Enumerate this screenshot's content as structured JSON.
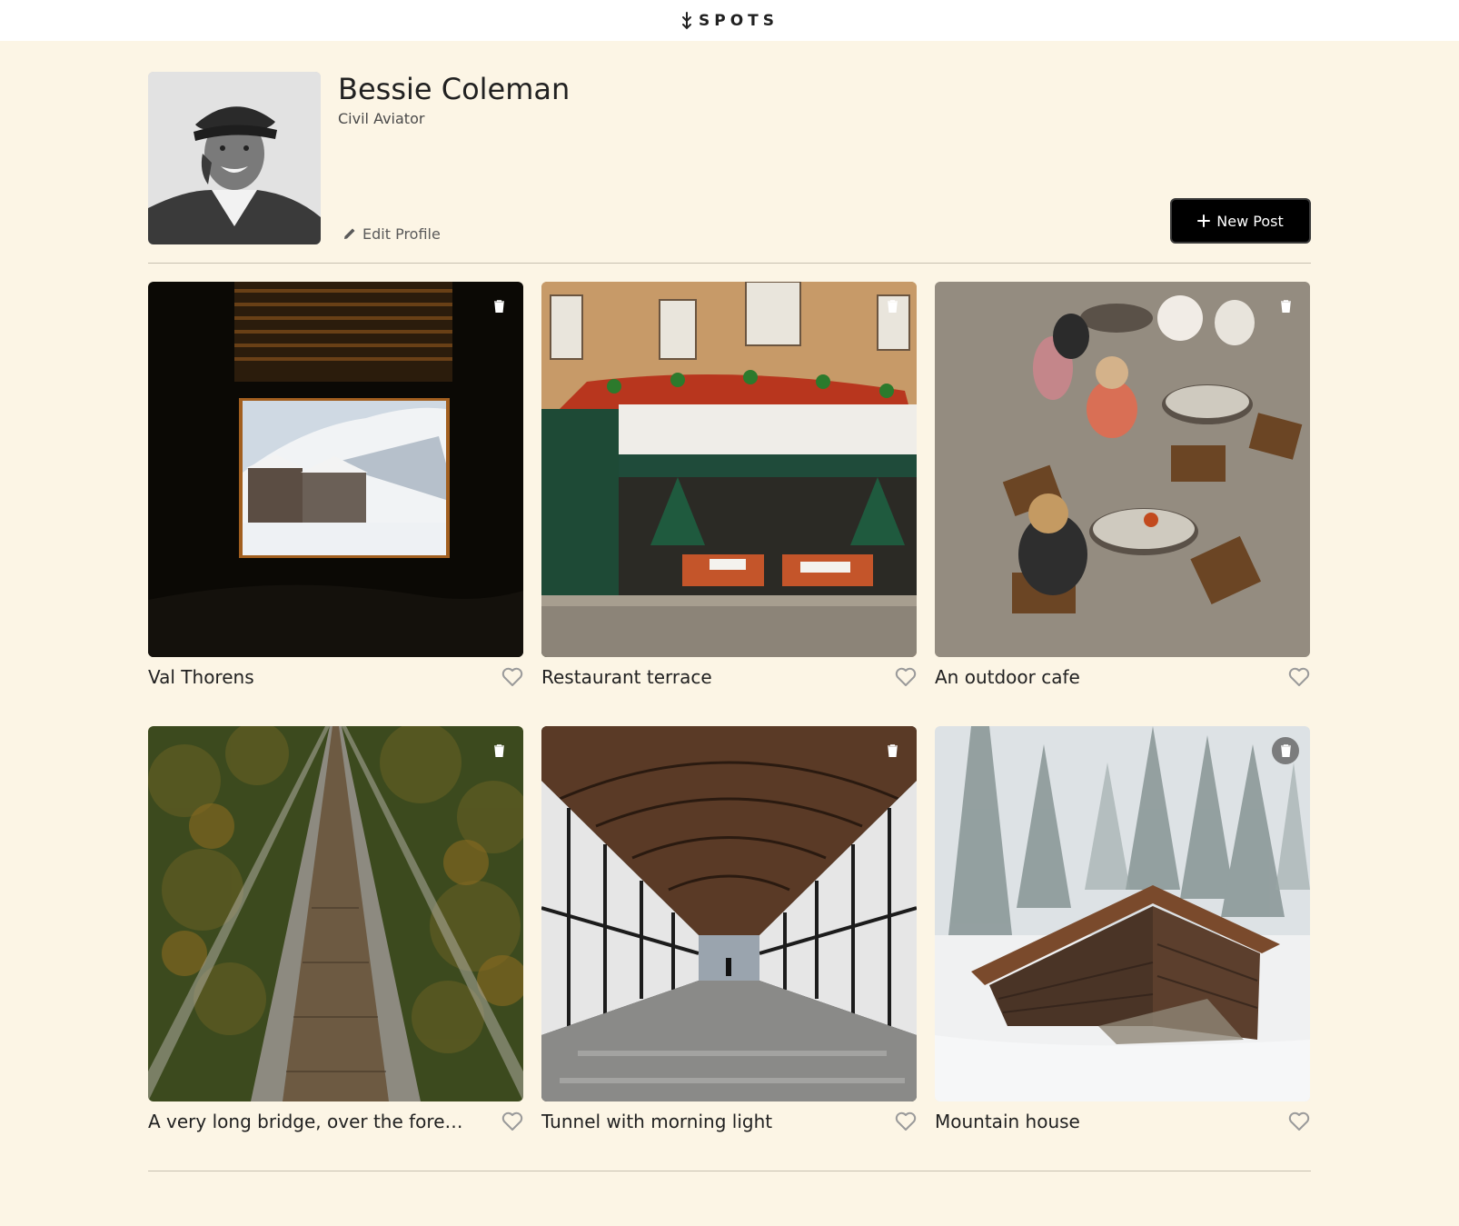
{
  "header": {
    "logo_text": "SPOTS"
  },
  "profile": {
    "name": "Bessie Coleman",
    "description": "Civil Aviator",
    "edit_label": "Edit Profile",
    "new_post_label": "New Post"
  },
  "cards": [
    {
      "title": "Val Thorens",
      "liked": false
    },
    {
      "title": "Restaurant terrace",
      "liked": false
    },
    {
      "title": "An outdoor cafe",
      "liked": false
    },
    {
      "title": "A very long bridge, over the forest and through the trees",
      "liked": false
    },
    {
      "title": "Tunnel with morning light",
      "liked": false
    },
    {
      "title": "Mountain house",
      "liked": false
    }
  ],
  "colors": {
    "page_background": "#FCF5E5",
    "header_background": "#FFFFFF",
    "primary_button": "#000000",
    "text": "#212121"
  },
  "icons": [
    "logo-icon",
    "pencil-icon",
    "plus-icon",
    "trash-icon",
    "heart-icon"
  ]
}
